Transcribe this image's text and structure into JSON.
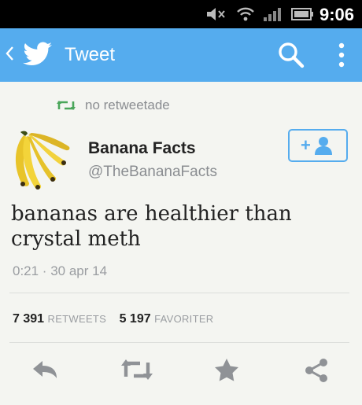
{
  "status_bar": {
    "time": "9:06",
    "icons": [
      "muted-volume-icon",
      "wifi-icon",
      "signal-icon",
      "battery-icon"
    ]
  },
  "header": {
    "title": "Tweet",
    "icons": [
      "back-chevron-icon",
      "twitter-bird-icon",
      "search-icon",
      "more-vert-icon"
    ],
    "color": "#55acee"
  },
  "retweet_context": {
    "text": "no retweetade",
    "icon": "retweet-icon"
  },
  "author": {
    "name": "Banana Facts",
    "handle": "@TheBananaFacts",
    "avatar": "banana-bunch"
  },
  "follow_button": {
    "label": "+",
    "icon": "person-add-icon",
    "color": "#55acee"
  },
  "tweet": {
    "text": "bananas are healthier than crystal meth",
    "timestamp": "0:21 · 30 apr 14"
  },
  "stats": {
    "retweets_count": "7 391",
    "retweets_label": "RETWEETS",
    "favorites_count": "5 197",
    "favorites_label": "FAVORITER"
  },
  "actions": [
    "reply-icon",
    "retweet-icon",
    "favorite-star-icon",
    "share-icon"
  ]
}
